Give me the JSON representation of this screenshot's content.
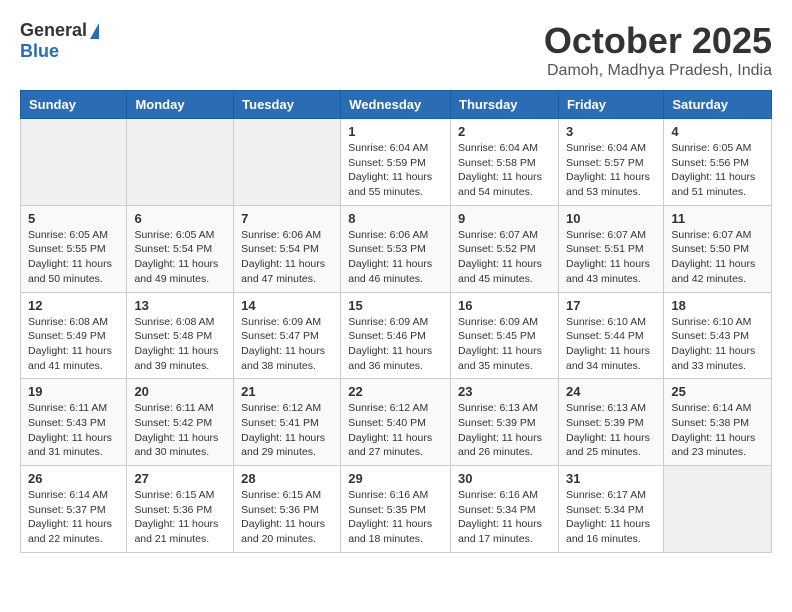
{
  "header": {
    "logo_general": "General",
    "logo_blue": "Blue",
    "title": "October 2025",
    "subtitle": "Damoh, Madhya Pradesh, India"
  },
  "columns": [
    "Sunday",
    "Monday",
    "Tuesday",
    "Wednesday",
    "Thursday",
    "Friday",
    "Saturday"
  ],
  "weeks": [
    {
      "days": [
        {
          "num": "",
          "info": ""
        },
        {
          "num": "",
          "info": ""
        },
        {
          "num": "",
          "info": ""
        },
        {
          "num": "1",
          "info": "Sunrise: 6:04 AM\nSunset: 5:59 PM\nDaylight: 11 hours\nand 55 minutes."
        },
        {
          "num": "2",
          "info": "Sunrise: 6:04 AM\nSunset: 5:58 PM\nDaylight: 11 hours\nand 54 minutes."
        },
        {
          "num": "3",
          "info": "Sunrise: 6:04 AM\nSunset: 5:57 PM\nDaylight: 11 hours\nand 53 minutes."
        },
        {
          "num": "4",
          "info": "Sunrise: 6:05 AM\nSunset: 5:56 PM\nDaylight: 11 hours\nand 51 minutes."
        }
      ]
    },
    {
      "days": [
        {
          "num": "5",
          "info": "Sunrise: 6:05 AM\nSunset: 5:55 PM\nDaylight: 11 hours\nand 50 minutes."
        },
        {
          "num": "6",
          "info": "Sunrise: 6:05 AM\nSunset: 5:54 PM\nDaylight: 11 hours\nand 49 minutes."
        },
        {
          "num": "7",
          "info": "Sunrise: 6:06 AM\nSunset: 5:54 PM\nDaylight: 11 hours\nand 47 minutes."
        },
        {
          "num": "8",
          "info": "Sunrise: 6:06 AM\nSunset: 5:53 PM\nDaylight: 11 hours\nand 46 minutes."
        },
        {
          "num": "9",
          "info": "Sunrise: 6:07 AM\nSunset: 5:52 PM\nDaylight: 11 hours\nand 45 minutes."
        },
        {
          "num": "10",
          "info": "Sunrise: 6:07 AM\nSunset: 5:51 PM\nDaylight: 11 hours\nand 43 minutes."
        },
        {
          "num": "11",
          "info": "Sunrise: 6:07 AM\nSunset: 5:50 PM\nDaylight: 11 hours\nand 42 minutes."
        }
      ]
    },
    {
      "days": [
        {
          "num": "12",
          "info": "Sunrise: 6:08 AM\nSunset: 5:49 PM\nDaylight: 11 hours\nand 41 minutes."
        },
        {
          "num": "13",
          "info": "Sunrise: 6:08 AM\nSunset: 5:48 PM\nDaylight: 11 hours\nand 39 minutes."
        },
        {
          "num": "14",
          "info": "Sunrise: 6:09 AM\nSunset: 5:47 PM\nDaylight: 11 hours\nand 38 minutes."
        },
        {
          "num": "15",
          "info": "Sunrise: 6:09 AM\nSunset: 5:46 PM\nDaylight: 11 hours\nand 36 minutes."
        },
        {
          "num": "16",
          "info": "Sunrise: 6:09 AM\nSunset: 5:45 PM\nDaylight: 11 hours\nand 35 minutes."
        },
        {
          "num": "17",
          "info": "Sunrise: 6:10 AM\nSunset: 5:44 PM\nDaylight: 11 hours\nand 34 minutes."
        },
        {
          "num": "18",
          "info": "Sunrise: 6:10 AM\nSunset: 5:43 PM\nDaylight: 11 hours\nand 33 minutes."
        }
      ]
    },
    {
      "days": [
        {
          "num": "19",
          "info": "Sunrise: 6:11 AM\nSunset: 5:43 PM\nDaylight: 11 hours\nand 31 minutes."
        },
        {
          "num": "20",
          "info": "Sunrise: 6:11 AM\nSunset: 5:42 PM\nDaylight: 11 hours\nand 30 minutes."
        },
        {
          "num": "21",
          "info": "Sunrise: 6:12 AM\nSunset: 5:41 PM\nDaylight: 11 hours\nand 29 minutes."
        },
        {
          "num": "22",
          "info": "Sunrise: 6:12 AM\nSunset: 5:40 PM\nDaylight: 11 hours\nand 27 minutes."
        },
        {
          "num": "23",
          "info": "Sunrise: 6:13 AM\nSunset: 5:39 PM\nDaylight: 11 hours\nand 26 minutes."
        },
        {
          "num": "24",
          "info": "Sunrise: 6:13 AM\nSunset: 5:39 PM\nDaylight: 11 hours\nand 25 minutes."
        },
        {
          "num": "25",
          "info": "Sunrise: 6:14 AM\nSunset: 5:38 PM\nDaylight: 11 hours\nand 23 minutes."
        }
      ]
    },
    {
      "days": [
        {
          "num": "26",
          "info": "Sunrise: 6:14 AM\nSunset: 5:37 PM\nDaylight: 11 hours\nand 22 minutes."
        },
        {
          "num": "27",
          "info": "Sunrise: 6:15 AM\nSunset: 5:36 PM\nDaylight: 11 hours\nand 21 minutes."
        },
        {
          "num": "28",
          "info": "Sunrise: 6:15 AM\nSunset: 5:36 PM\nDaylight: 11 hours\nand 20 minutes."
        },
        {
          "num": "29",
          "info": "Sunrise: 6:16 AM\nSunset: 5:35 PM\nDaylight: 11 hours\nand 18 minutes."
        },
        {
          "num": "30",
          "info": "Sunrise: 6:16 AM\nSunset: 5:34 PM\nDaylight: 11 hours\nand 17 minutes."
        },
        {
          "num": "31",
          "info": "Sunrise: 6:17 AM\nSunset: 5:34 PM\nDaylight: 11 hours\nand 16 minutes."
        },
        {
          "num": "",
          "info": ""
        }
      ]
    }
  ]
}
